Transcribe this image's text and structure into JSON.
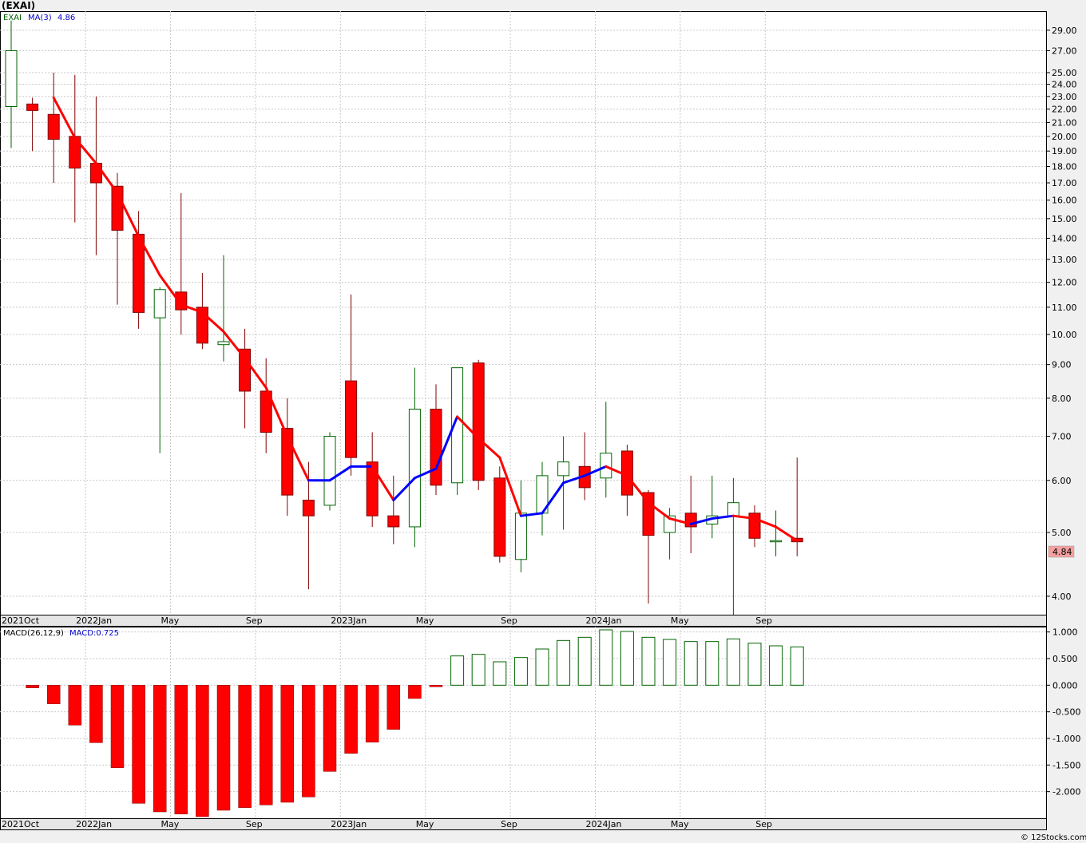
{
  "title": "(EXAI)",
  "watermark": "© 12Stocks.com",
  "legend": {
    "symbol": "EXAI",
    "ma_label": "MA(3)",
    "ma_value": "4.86",
    "macd_label": "MACD(26,12,9)",
    "macd_value": "MACD:0.725"
  },
  "last_price_label": "4.84",
  "colors": {
    "down": "#ff0000",
    "up_border": "#006400",
    "ma_down": "#ff0000",
    "ma_up": "#0000ff",
    "price_badge": "#f4a0a0",
    "grid": "#c8c8c8"
  },
  "chart_data": [
    {
      "type": "candlestick",
      "scale": "log",
      "ylim": [
        3.75,
        31
      ],
      "x_labels": [
        "2021Oct",
        "2022Jan",
        "May",
        "Sep",
        "2023Jan",
        "May",
        "Sep",
        "2024Jan",
        "May",
        "Sep"
      ],
      "x_label_index": [
        0,
        3.5,
        7.5,
        11.5,
        15.5,
        19.5,
        23.5,
        27.5,
        31.5,
        35.5
      ],
      "y_ticks": [
        "29.00",
        "27.00",
        "25.00",
        "24.00",
        "23.00",
        "22.00",
        "21.00",
        "20.00",
        "19.00",
        "18.00",
        "17.00",
        "16.00",
        "15.00",
        "14.00",
        "13.00",
        "12.00",
        "11.00",
        "10.00",
        "9.00",
        "8.00",
        "7.00",
        "6.00",
        "5.00",
        "4.00"
      ],
      "candles": [
        {
          "o": 22.2,
          "h": 30.0,
          "l": 19.2,
          "c": 27.0
        },
        {
          "o": 22.4,
          "h": 22.9,
          "l": 19.0,
          "c": 21.9
        },
        {
          "o": 21.6,
          "h": 25.0,
          "l": 17.0,
          "c": 19.8
        },
        {
          "o": 20.0,
          "h": 24.8,
          "l": 14.8,
          "c": 17.9
        },
        {
          "o": 18.2,
          "h": 23.0,
          "l": 13.2,
          "c": 17.0
        },
        {
          "o": 16.8,
          "h": 17.6,
          "l": 11.1,
          "c": 14.4
        },
        {
          "o": 14.2,
          "h": 15.4,
          "l": 10.2,
          "c": 10.8
        },
        {
          "o": 10.6,
          "h": 11.8,
          "l": 6.6,
          "c": 11.7
        },
        {
          "o": 11.6,
          "h": 16.4,
          "l": 10.0,
          "c": 10.9
        },
        {
          "o": 11.0,
          "h": 12.4,
          "l": 9.5,
          "c": 9.7
        },
        {
          "o": 9.65,
          "h": 13.2,
          "l": 9.1,
          "c": 9.75
        },
        {
          "o": 9.5,
          "h": 10.2,
          "l": 7.2,
          "c": 8.2
        },
        {
          "o": 8.2,
          "h": 9.2,
          "l": 6.6,
          "c": 7.1
        },
        {
          "o": 7.2,
          "h": 8.0,
          "l": 5.3,
          "c": 5.7
        },
        {
          "o": 5.6,
          "h": 6.4,
          "l": 4.1,
          "c": 5.3
        },
        {
          "o": 5.5,
          "h": 7.1,
          "l": 5.4,
          "c": 7.0
        },
        {
          "o": 8.5,
          "h": 11.5,
          "l": 6.1,
          "c": 6.5
        },
        {
          "o": 6.4,
          "h": 7.1,
          "l": 5.1,
          "c": 5.3
        },
        {
          "o": 5.3,
          "h": 6.1,
          "l": 4.8,
          "c": 5.1
        },
        {
          "o": 5.1,
          "h": 8.9,
          "l": 4.75,
          "c": 7.7
        },
        {
          "o": 7.7,
          "h": 8.4,
          "l": 5.7,
          "c": 5.9
        },
        {
          "o": 5.95,
          "h": 8.9,
          "l": 5.7,
          "c": 8.9
        },
        {
          "o": 9.05,
          "h": 9.15,
          "l": 5.8,
          "c": 6.0
        },
        {
          "o": 6.05,
          "h": 6.3,
          "l": 4.5,
          "c": 4.6
        },
        {
          "o": 4.55,
          "h": 6.0,
          "l": 4.35,
          "c": 5.35
        },
        {
          "o": 5.35,
          "h": 6.4,
          "l": 4.95,
          "c": 6.1
        },
        {
          "o": 6.1,
          "h": 7.0,
          "l": 5.05,
          "c": 6.4
        },
        {
          "o": 6.3,
          "h": 7.1,
          "l": 5.6,
          "c": 5.85
        },
        {
          "o": 6.05,
          "h": 7.9,
          "l": 5.65,
          "c": 6.6
        },
        {
          "o": 6.65,
          "h": 6.8,
          "l": 5.3,
          "c": 5.7
        },
        {
          "o": 5.75,
          "h": 5.8,
          "l": 3.9,
          "c": 4.95
        },
        {
          "o": 5.0,
          "h": 5.45,
          "l": 4.55,
          "c": 5.3
        },
        {
          "o": 5.35,
          "h": 6.1,
          "l": 4.65,
          "c": 5.1
        },
        {
          "o": 5.15,
          "h": 6.1,
          "l": 4.9,
          "c": 5.3
        },
        {
          "o": 5.3,
          "h": 6.05,
          "l": 3.75,
          "c": 5.55
        },
        {
          "o": 5.35,
          "h": 5.5,
          "l": 4.75,
          "c": 4.9
        },
        {
          "o": 4.86,
          "h": 5.4,
          "l": 4.6,
          "c": 4.86
        },
        {
          "o": 4.9,
          "h": 6.5,
          "l": 4.6,
          "c": 4.84
        }
      ],
      "ma3": [
        null,
        null,
        22.9,
        19.9,
        18.2,
        16.4,
        14.1,
        12.3,
        11.1,
        10.8,
        10.1,
        9.2,
        8.3,
        7.0,
        6.0,
        6.0,
        6.3,
        6.3,
        5.6,
        6.05,
        6.25,
        7.5,
        6.95,
        6.5,
        5.3,
        5.35,
        5.95,
        6.1,
        6.3,
        6.1,
        5.55,
        5.25,
        5.15,
        5.25,
        5.3,
        5.25,
        5.1,
        4.86
      ]
    },
    {
      "type": "bar",
      "title": "MACD(26,12,9)",
      "ylim": [
        -2.5,
        1.1
      ],
      "y_ticks": [
        "1.000",
        "0.500",
        "0.000",
        "-0.500",
        "-1.000",
        "-1.500",
        "-2.000"
      ],
      "y_tick_values": [
        1.0,
        0.5,
        0.0,
        -0.5,
        -1.0,
        -1.5,
        -2.0
      ],
      "values": [
        null,
        -0.05,
        -0.35,
        -0.75,
        -1.08,
        -1.55,
        -2.22,
        -2.38,
        -2.42,
        -2.47,
        -2.35,
        -2.3,
        -2.25,
        -2.2,
        -2.1,
        -1.62,
        -1.28,
        -1.07,
        -0.83,
        -0.25,
        -0.03,
        0.55,
        0.58,
        0.44,
        0.52,
        0.68,
        0.84,
        0.9,
        1.04,
        1.01,
        0.9,
        0.86,
        0.82,
        0.82,
        0.87,
        0.79,
        0.74,
        0.72
      ]
    }
  ]
}
